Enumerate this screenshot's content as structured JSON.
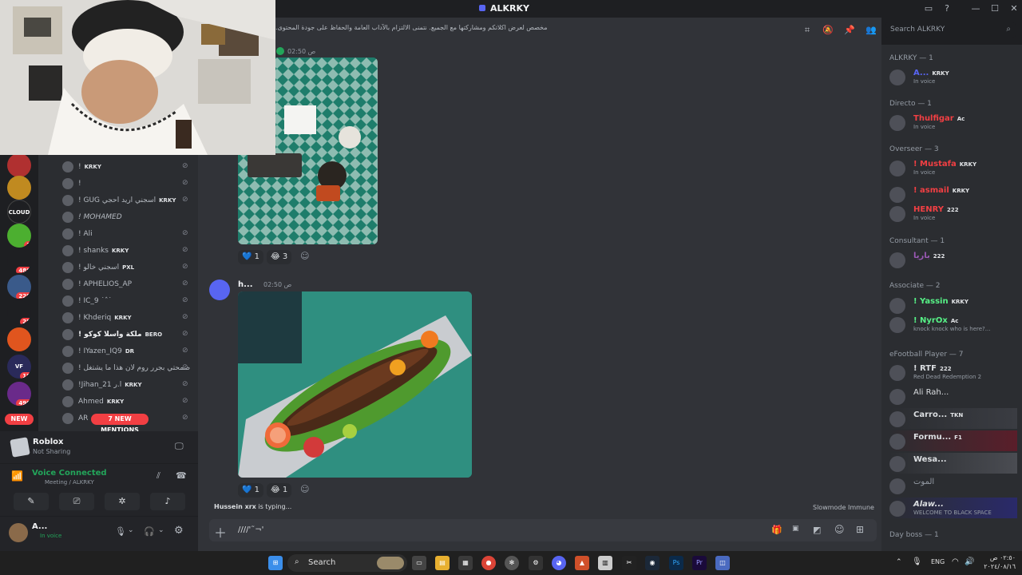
{
  "window": {
    "title": "ALKRKY"
  },
  "server_rail": {
    "servers": [
      {
        "label": "",
        "badge": ""
      },
      {
        "label": "",
        "badge": ""
      },
      {
        "label": "CLOUD",
        "badge": ""
      },
      {
        "label": "",
        "badge": "1"
      },
      {
        "label": "",
        "badge": "488"
      },
      {
        "label": "",
        "badge": "229"
      },
      {
        "label": "",
        "badge": "25"
      },
      {
        "label": "",
        "badge": ""
      },
      {
        "label": "VF",
        "badge": "18"
      },
      {
        "label": "",
        "badge": "490"
      }
    ],
    "new_label": "NEW"
  },
  "voice_users": [
    {
      "name": "!",
      "tag": "KRKY"
    },
    {
      "name": "!",
      "tag": ""
    },
    {
      "name": "! GUG اسجني اريد احجي",
      "tag": "KRKY"
    },
    {
      "name": "! MOHAMED",
      "tag": ""
    },
    {
      "name": "! Ali",
      "tag": ""
    },
    {
      "name": "! shanks",
      "tag": "KRKY"
    },
    {
      "name": "! اسجني خالو",
      "tag": "PXL"
    },
    {
      "name": "! APHELIOS_AP",
      "tag": ""
    },
    {
      "name": "! IC_9 ˙ˆ˙",
      "tag": ""
    },
    {
      "name": "! Khderiq",
      "tag": "KRKY"
    },
    {
      "name": "! ملكة واسلا كوكو",
      "tag": "BERO"
    },
    {
      "name": "! IYazen_IQ9",
      "tag": "DR"
    },
    {
      "name": "! صمحتي بجرر روم لان هذا ما يشتغل",
      "tag": ""
    },
    {
      "name": "!Jihan_21 ا.ر",
      "tag": "KRKY"
    },
    {
      "name": "Ahmed",
      "tag": "KRKY"
    },
    {
      "name": "AR",
      "tag": ""
    }
  ],
  "mentions_label": "7 NEW MENTIONS",
  "activity": {
    "game": "Roblox",
    "status": "Not Sharing"
  },
  "voice_panel": {
    "status": "Voice Connected",
    "channel": "Meeting / ALKRKY"
  },
  "user_panel": {
    "name": "A...",
    "status": "In voice"
  },
  "header": {
    "topic": ".هذا الروم مخصص لعرض اكلاتكم ومشاركتها مع الجميع. نتمنى الالتزام بالآداب العامة والحفاظ على جودة المحتوى",
    "search_placeholder": "Search ALKRKY"
  },
  "messages": [
    {
      "time": "02:50 ص",
      "reactions": [
        {
          "emoji": "💙",
          "count": "1"
        },
        {
          "emoji": "😂",
          "count": "3"
        }
      ]
    },
    {
      "author": "h...",
      "time": "02:50 ص",
      "reactions": [
        {
          "emoji": "💙",
          "count": "1"
        },
        {
          "emoji": "😂",
          "count": "1"
        }
      ]
    }
  ],
  "typing": {
    "who": "Hussein xrx",
    "suffix": "is typing..."
  },
  "slowmode": "Slowmode Immune",
  "composer": {
    "value": "////'˜¬'"
  },
  "members": {
    "groups": [
      {
        "header": "ALKRKY — 1",
        "members": [
          {
            "name": "A...",
            "tag": "KRKY",
            "status": "In voice",
            "color": "#5865f2"
          }
        ]
      },
      {
        "header": "Directo — 1",
        "members": [
          {
            "name": "Thulfigar",
            "tag": "Ac",
            "status": "In voice",
            "color": "#f23f43"
          }
        ]
      },
      {
        "header": "Overseer — 3",
        "members": [
          {
            "name": "! Mustafa",
            "tag": "KRKY",
            "status": "In voice",
            "color": "#f23f43"
          },
          {
            "name": "! asmail",
            "tag": "KRKY",
            "status": "",
            "color": "#f23f43"
          },
          {
            "name": "HENRY",
            "tag": "222",
            "status": "In voice",
            "color": "#f23f43"
          }
        ]
      },
      {
        "header": "Consultant — 1",
        "members": [
          {
            "name": "باريا",
            "tag": "222",
            "status": "",
            "color": "#9b59b6"
          }
        ]
      },
      {
        "header": "Associate — 2",
        "members": [
          {
            "name": "! Yassin",
            "tag": "KRKY",
            "status": "",
            "color": "#57f287"
          },
          {
            "name": "! NyrOx",
            "tag": "Ac",
            "status": "knock knock who is here?...",
            "color": "#57f287"
          }
        ]
      },
      {
        "header": "eFootball Player — 7",
        "members": [
          {
            "name": "! RTF",
            "tag": "222",
            "status": "Red Dead Redemption 2",
            "color": "#dbdee1"
          },
          {
            "name": "Ali Rah...",
            "tag": "",
            "status": "",
            "color": "#dbdee1"
          },
          {
            "name": "Carro...",
            "tag": "TKN",
            "status": "",
            "color": "#dbdee1"
          },
          {
            "name": "Formu...",
            "tag": "F1",
            "status": "",
            "color": "#dbdee1"
          },
          {
            "name": "Wesa...",
            "tag": "",
            "status": "",
            "color": "#dbdee1"
          },
          {
            "name": "الموت",
            "tag": "",
            "status": "",
            "color": "#949ba4"
          },
          {
            "name": "Alaw...",
            "tag": "",
            "status": "WELCOME TO BLACK SPACE",
            "color": "#dbdee1"
          }
        ]
      },
      {
        "header": "Day boss — 1",
        "members": []
      }
    ]
  },
  "taskbar": {
    "search_label": "Search",
    "lang": "ENG",
    "time": "٠٢:٥٠ ص",
    "date": "٢٠٢٤/٠٨/١٦"
  },
  "colors": {
    "accent": "#5865f2",
    "danger": "#f23f43",
    "online": "#23a55a"
  }
}
